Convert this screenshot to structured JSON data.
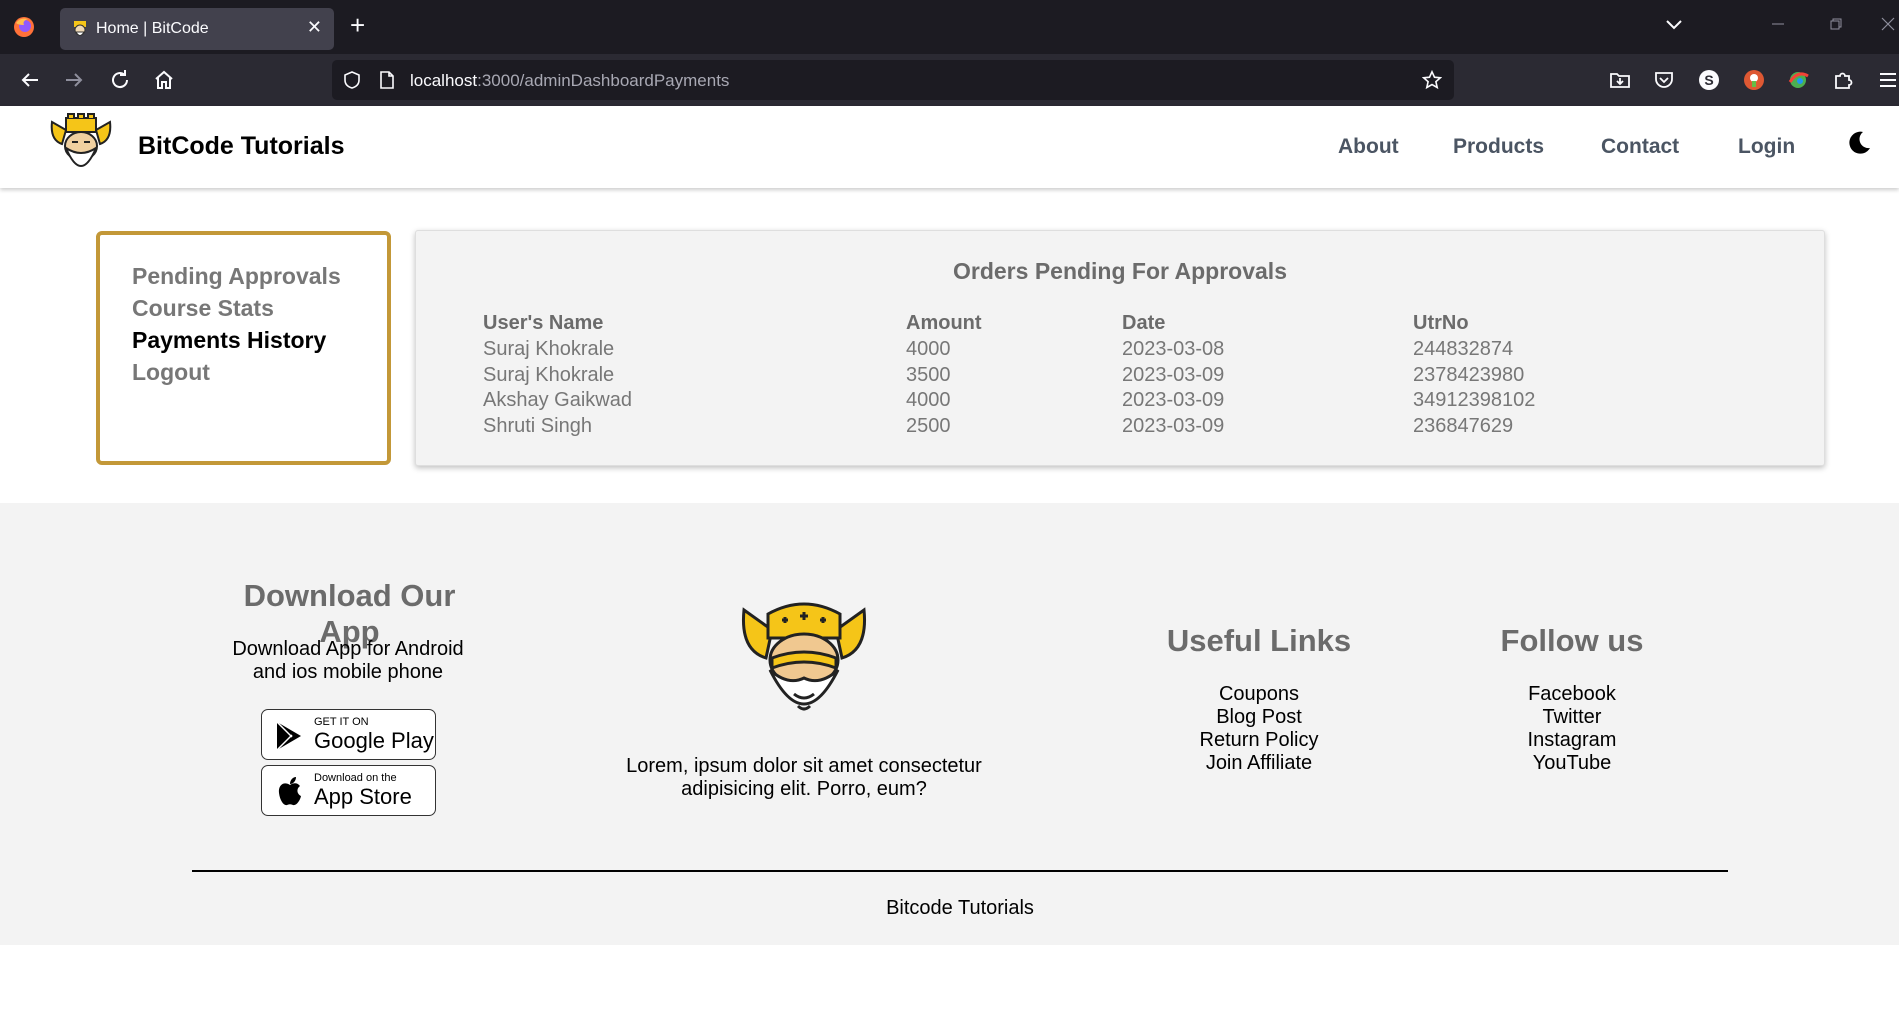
{
  "browser": {
    "tab_title": "Home | BitCode",
    "url_host": "localhost",
    "url_path": ":3000/adminDashboardPayments"
  },
  "header": {
    "brand": "BitCode Tutorials",
    "nav": [
      "About",
      "Products",
      "Contact",
      "Login"
    ]
  },
  "sidebar": {
    "items": [
      "Pending Approvals",
      "Course Stats",
      "Payments History",
      "Logout"
    ],
    "active": "Payments History"
  },
  "panel": {
    "title": "Orders Pending For Approvals",
    "columns": [
      "User's Name",
      "Amount",
      "Date",
      "UtrNo"
    ],
    "rows": [
      [
        "Suraj Khokrale",
        "4000",
        "2023-03-08",
        "244832874"
      ],
      [
        "Suraj Khokrale",
        "3500",
        "2023-03-09",
        "2378423980"
      ],
      [
        "Akshay Gaikwad",
        "4000",
        "2023-03-09",
        "34912398102"
      ],
      [
        "Shruti Singh",
        "2500",
        "2023-03-09",
        "236847629"
      ]
    ]
  },
  "footer": {
    "download": {
      "heading": "Download Our App",
      "text_line1": "Download App for Android",
      "text_line2": "and ios mobile phone",
      "google_small": "GET IT ON",
      "google_big": "Google Play",
      "apple_small": "Download on the",
      "apple_big": "App Store"
    },
    "about": {
      "line1": "Lorem, ipsum dolor sit amet consectetur",
      "line2": "adipisicing elit. Porro, eum?"
    },
    "useful_links": {
      "heading": "Useful Links",
      "links": [
        "Coupons",
        "Blog Post",
        "Return Policy",
        "Join Affiliate"
      ]
    },
    "follow": {
      "heading": "Follow us",
      "links": [
        "Facebook",
        "Twitter",
        "Instagram",
        "YouTube"
      ]
    },
    "copyright": "Bitcode Tutorials"
  },
  "colors": {
    "sidebar_border": "#c39838",
    "logo_gold": "#f5c518",
    "chrome_dark": "#1c1b22"
  }
}
